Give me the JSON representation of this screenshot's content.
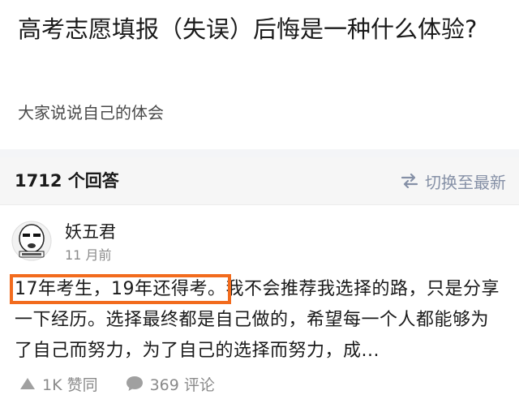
{
  "question": {
    "title": "高考志愿填报（失误）后悔是一种什么体验?",
    "description": "大家说说自己的体会"
  },
  "answers_bar": {
    "count_label": "1712 个回答",
    "sort_label": "切换至最新"
  },
  "answer": {
    "author": "妖五君",
    "time": "11 月前",
    "highlighted_text": "17年考生，19年还得考。",
    "body_text": "我不会推荐我选择的路，只是分享一下经历。选择最终都是自己做的，希望每一个人都能够为了自己而努力，为了自己的选择而努力，成...",
    "upvote_label": "1K 赞同",
    "comment_label": "369 评论"
  },
  "colors": {
    "highlight_border": "#f26b1d",
    "muted": "#8a8a8a",
    "sort_text": "#8590a6"
  },
  "icons": [
    "avatar-meme-face",
    "swap-arrows-icon",
    "upvote-triangle-icon",
    "comment-bubble-icon"
  ]
}
